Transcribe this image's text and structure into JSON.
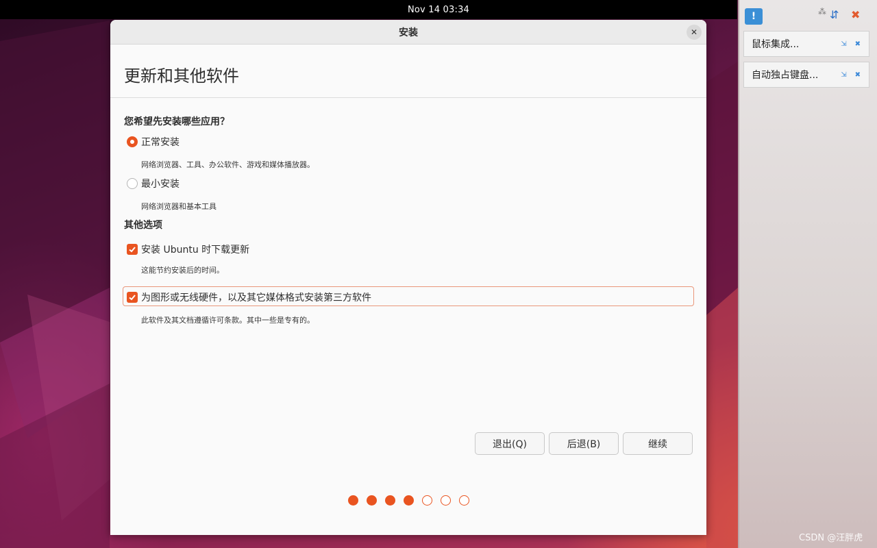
{
  "topbar": {
    "clock": "Nov 14  03:34"
  },
  "window": {
    "title": "安装",
    "heading": "更新和其他软件",
    "question": "您希望先安装哪些应用？",
    "install_options": [
      {
        "label": "正常安装",
        "description": "网络浏览器、工具、办公软件、游戏和媒体播放器。",
        "selected": true
      },
      {
        "label": "最小安装",
        "description": "网络浏览器和基本工具",
        "selected": false
      }
    ],
    "other_title": "其他选项",
    "other_options": [
      {
        "label": "安装 Ubuntu 时下载更新",
        "description": "这能节约安装后的时间。",
        "checked": true
      },
      {
        "label": "为图形或无线硬件，以及其它媒体格式安装第三方软件",
        "description": "此软件及其文档遵循许可条款。其中一些是专有的。",
        "checked": true
      }
    ],
    "buttons": {
      "quit": "退出(Q)",
      "back": "后退(B)",
      "continue": "继续"
    },
    "progress": {
      "total_steps": 7,
      "completed_steps": 4
    }
  },
  "side_panel": {
    "notifications": [
      {
        "text": "鼠标集成..."
      },
      {
        "text": "自动独占键盘..."
      }
    ]
  },
  "watermark": "CSDN @汪胖虎",
  "colors": {
    "accent": "#e95420",
    "topbar": "#000000",
    "window_bg": "#fafafa"
  }
}
